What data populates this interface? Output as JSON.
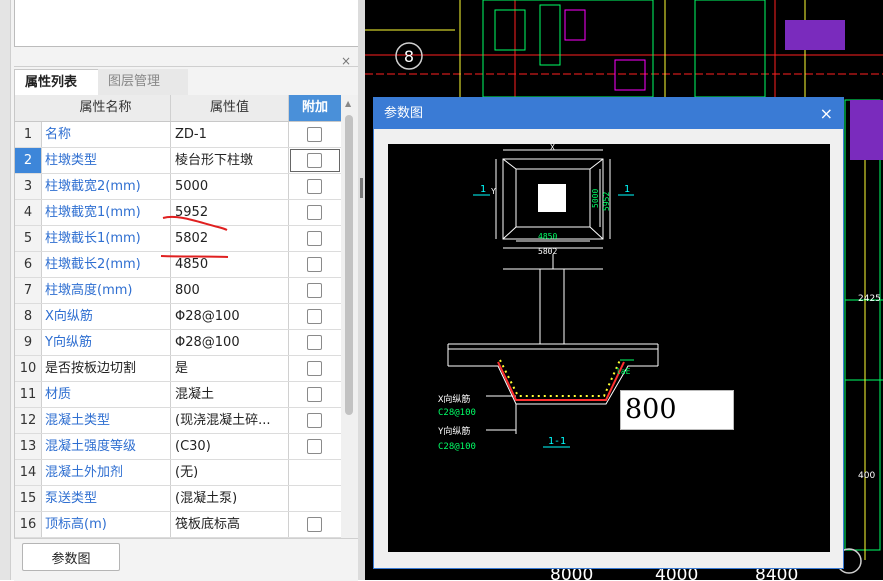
{
  "tabs": [
    "属性列表",
    "图层管理"
  ],
  "panel_close": "×",
  "columns": {
    "name": "属性名称",
    "value": "属性值",
    "extra": "附加"
  },
  "rows": [
    {
      "idx": "1",
      "name": "名称",
      "value": "ZD-1",
      "checkbox": true
    },
    {
      "idx": "2",
      "name": "柱墩类型",
      "value": "棱台形下柱墩",
      "checkbox": true
    },
    {
      "idx": "3",
      "name": "柱墩截宽2(mm)",
      "value": "5000",
      "checkbox": true
    },
    {
      "idx": "4",
      "name": "柱墩截宽1(mm)",
      "value": "5952",
      "checkbox": true
    },
    {
      "idx": "5",
      "name": "柱墩截长1(mm)",
      "value": "5802",
      "checkbox": true
    },
    {
      "idx": "6",
      "name": "柱墩截长2(mm)",
      "value": "4850",
      "checkbox": true
    },
    {
      "idx": "7",
      "name": "柱墩高度(mm)",
      "value": "800",
      "checkbox": true
    },
    {
      "idx": "8",
      "name": "X向纵筋",
      "value": "Φ28@100",
      "checkbox": true
    },
    {
      "idx": "9",
      "name": "Y向纵筋",
      "value": "Φ28@100",
      "checkbox": true
    },
    {
      "idx": "10",
      "name": "是否按板边切割",
      "value": "是",
      "checkbox": true
    },
    {
      "idx": "11",
      "name": "材质",
      "value": "混凝土",
      "checkbox": true
    },
    {
      "idx": "12",
      "name": "混凝土类型",
      "value": "(现浇混凝土碎...",
      "checkbox": true
    },
    {
      "idx": "13",
      "name": "混凝土强度等级",
      "value": "(C30)",
      "checkbox": true
    },
    {
      "idx": "14",
      "name": "混凝土外加剂",
      "value": "(无)",
      "checkbox": false
    },
    {
      "idx": "15",
      "name": "泵送类型",
      "value": "(混凝土泵)",
      "checkbox": false
    },
    {
      "idx": "16",
      "name": "顶标高(m)",
      "value": "筏板底标高",
      "checkbox": true
    }
  ],
  "selected_row": "2",
  "bottom_button": "参数图",
  "dialog": {
    "title": "参数图",
    "close": "×",
    "input_value": "800",
    "drawing": {
      "top_dim_x": "X",
      "left_label_y": "Y",
      "dim_5000": "5000",
      "dim_5952": "5952",
      "dim_4850": "4850",
      "dim_5802": "5802",
      "section_mark": "1",
      "label_lae": "laE",
      "label_x_bar": "X向纵筋",
      "label_x_spec": "C28@100",
      "label_y_bar": "Y向纵筋",
      "label_y_spec": "C28@100",
      "section_title": "1-1"
    }
  },
  "cad": {
    "axis_label": "8",
    "bottom_dims": [
      "8000",
      "4000",
      "8400"
    ],
    "small_labels": [
      "2425",
      "400"
    ]
  },
  "colors": {
    "accent": "#3a7bd5",
    "selected_row": "#3d86d9",
    "link_text": "#2f6fd1",
    "annotation_red": "#e02020",
    "cad_green": "#00ff66",
    "cad_yellow": "#ffff33",
    "cad_magenta": "#ff00ff",
    "cad_cyan": "#00ffff"
  }
}
